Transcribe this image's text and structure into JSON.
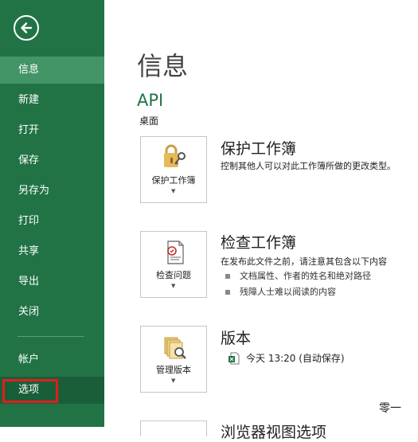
{
  "sidebar": {
    "items": [
      {
        "label": "信息",
        "top": 0
      },
      {
        "label": "新建"
      },
      {
        "label": "打开"
      },
      {
        "label": "保存"
      },
      {
        "label": "另存为"
      },
      {
        "label": "打印"
      },
      {
        "label": "共享"
      },
      {
        "label": "导出"
      },
      {
        "label": "关闭"
      },
      {
        "label": "帐户"
      },
      {
        "label": "选项"
      }
    ],
    "active": "信息",
    "accent": "#217346"
  },
  "main": {
    "title": "信息",
    "workbook_name": "API",
    "location": "桌面",
    "sections": [
      {
        "button_label": "保护工作簿",
        "title": "保护工作簿",
        "desc": "控制其他人可以对此工作簿所做的更改类型。",
        "icon": "lock-key-icon"
      },
      {
        "button_label": "检查问题",
        "title": "检查工作簿",
        "desc": "在发布此文件之前，请注意其包含以下内容",
        "bullets": [
          "文档属性、作者的姓名和绝对路径",
          "残障人士难以阅读的内容"
        ],
        "icon": "inspect-document-icon"
      },
      {
        "button_label": "管理版本",
        "title": "版本",
        "version": "今天 13:20 (自动保存)",
        "icon": "versions-icon"
      },
      {
        "title": "浏览器视图选项"
      }
    ]
  },
  "watermark": "零一"
}
